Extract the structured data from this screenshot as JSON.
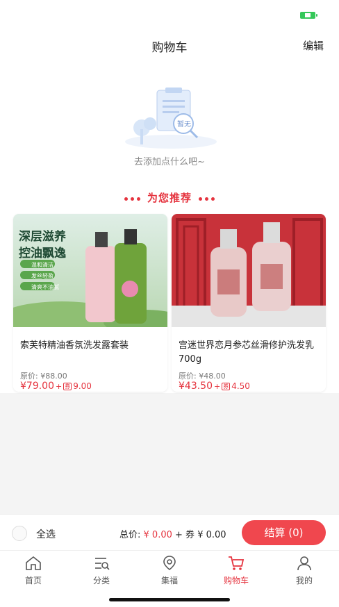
{
  "nav": {
    "title": "购物车",
    "edit_label": "编辑"
  },
  "empty": {
    "badge": "暂无",
    "text": "去添加点什么吧~"
  },
  "recommend": {
    "title": "为您推荐"
  },
  "products": [
    {
      "name": "索芙特精油香氛洗发露套装",
      "original_price": "原价: ¥88.00",
      "price": "¥79.00",
      "plus": "+",
      "coupon_tag": "券",
      "coupon_value": "9.00",
      "image_headline_1": "深层滋养",
      "image_headline_2": "控油飘逸",
      "image_features": [
        "温和清洁",
        "发丝轻盈",
        "清爽不油腻"
      ]
    },
    {
      "name": "宫迷世界恋月参芯丝滑修护洗发乳700g",
      "original_price": "原价: ¥48.00",
      "price": "¥43.50",
      "plus": "+",
      "coupon_tag": "券",
      "coupon_value": "4.50"
    }
  ],
  "checkout": {
    "select_all": "全选",
    "total_label": "总价:",
    "total_amount": "¥ 0.00",
    "coupon_part": "+ 券 ¥ 0.00",
    "button": "结算 (0)"
  },
  "tabs": [
    {
      "label": "首页",
      "icon": "home-icon"
    },
    {
      "label": "分类",
      "icon": "category-icon"
    },
    {
      "label": "集福",
      "icon": "location-icon"
    },
    {
      "label": "购物车",
      "icon": "cart-icon",
      "active": true
    },
    {
      "label": "我的",
      "icon": "user-icon"
    }
  ],
  "colors": {
    "accent": "#e5333e",
    "checkout_button": "#f0474e",
    "battery": "#34c759"
  }
}
